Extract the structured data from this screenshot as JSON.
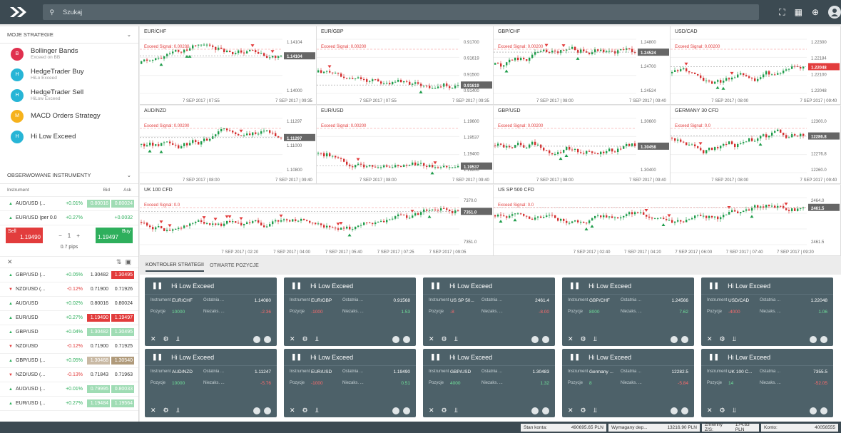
{
  "search": {
    "placeholder": "Szukaj"
  },
  "strategies_header": "MOJE STRATEGIE",
  "strategies": [
    {
      "letter": "B",
      "color": "#e0304e",
      "name": "Bollinger Bands",
      "sub": "Exceed on BB"
    },
    {
      "letter": "H",
      "color": "#27b5d6",
      "name": "HedgeTrader Buy",
      "sub": "HiLo Exceed"
    },
    {
      "letter": "H",
      "color": "#27b5d6",
      "name": "HedgeTrader Sell",
      "sub": "HiLow Exceed"
    },
    {
      "letter": "M",
      "color": "#f6b21c",
      "name": "MACD Orders Strategy",
      "sub": ""
    },
    {
      "letter": "H",
      "color": "#27b5d6",
      "name": "Hi Low Exceed",
      "sub": ""
    }
  ],
  "observed_header": "OBSERWOWANE INSTRUMENTY",
  "inst_cols": {
    "instrument": "Instrument",
    "bid": "Bid",
    "ask": "Ask"
  },
  "instruments_top": [
    {
      "dir": "up",
      "name": "AUD/USD (...",
      "change": "+0.01%",
      "bid": "0.80016",
      "ask": "0.80024",
      "bidbg": "#9fdcb4",
      "askbg": "#9fdcb4"
    },
    {
      "dir": "up",
      "name": "EUR/USD (per 0.000...",
      "change": "+0.27%",
      "bid": "",
      "ask": "+0.0032",
      "bidbg": "",
      "askbg": ""
    }
  ],
  "trade": {
    "sell_label": "Sell",
    "sell_price": "1.19490",
    "buy_label": "Buy",
    "buy_price": "1.19497",
    "qty": "1",
    "pips": "0.7 pips"
  },
  "instruments": [
    {
      "dir": "up",
      "name": "GBP/USD (...",
      "change": "+0.05%",
      "bid": "1.30482",
      "ask": "1.30495",
      "bidbg": "",
      "askbg": "#e23c3c"
    },
    {
      "dir": "dn",
      "name": "NZD/USD (...",
      "change": "-0.12%",
      "bid": "0.71900",
      "ask": "0.71926",
      "bidbg": "",
      "askbg": ""
    },
    {
      "dir": "up",
      "name": "AUD/USD",
      "change": "+0.02%",
      "bid": "0.80016",
      "ask": "0.80024",
      "bidbg": "",
      "askbg": ""
    },
    {
      "dir": "up",
      "name": "EUR/USD",
      "change": "+0.27%",
      "bid": "1.19490",
      "ask": "1.19497",
      "bidbg": "#e23c3c",
      "askbg": "#e23c3c"
    },
    {
      "dir": "up",
      "name": "GBP/USD",
      "change": "+0.04%",
      "bid": "1.30482",
      "ask": "1.30495",
      "bidbg": "#9fdcb4",
      "askbg": "#9fdcb4"
    },
    {
      "dir": "dn",
      "name": "NZD/USD",
      "change": "-0.12%",
      "bid": "0.71900",
      "ask": "0.71925",
      "bidbg": "",
      "askbg": ""
    },
    {
      "dir": "up",
      "name": "GBP/USD (...",
      "change": "+0.05%",
      "bid": "1.30468",
      "ask": "1.30540",
      "bidbg": "#c9b9a4",
      "askbg": "#b09a7a"
    },
    {
      "dir": "dn",
      "name": "NZD/USD (...",
      "change": "-0.13%",
      "bid": "0.71843",
      "ask": "0.71963",
      "bidbg": "",
      "askbg": ""
    },
    {
      "dir": "up",
      "name": "AUD/USD (...",
      "change": "+0.01%",
      "bid": "0.79995",
      "ask": "0.80033",
      "bidbg": "#9fdcb4",
      "askbg": "#9fdcb4"
    },
    {
      "dir": "up",
      "name": "EUR/USD (...",
      "change": "+0.27%",
      "bid": "1.19484",
      "ask": "1.19564",
      "bidbg": "#9fdcb4",
      "askbg": "#9fdcb4"
    }
  ],
  "charts": [
    {
      "title": "EUR/CHF",
      "signal": "Exceed Signal: 0.00200",
      "prices": [
        "1.14104",
        "1.14000"
      ],
      "times": [
        "7 SEP 2017 | 07:55",
        "7 SEP 2017 | 09:35"
      ],
      "badge": "1.14104",
      "badgebg": "#666"
    },
    {
      "title": "EUR/GBP",
      "signal": "Exceed Signal: 0.00200",
      "prices": [
        "0.91700",
        "0.91619",
        "0.91500",
        "0.91400"
      ],
      "times": [
        "7 SEP 2017 | 07:55",
        "7 SEP 2017 | 09:35"
      ],
      "badge": "0.91619",
      "badgebg": "#666"
    },
    {
      "title": "GBP/CHF",
      "signal": "Exceed Signal: 0.00200",
      "prices": [
        "1.24800",
        "1.24700",
        "1.24524"
      ],
      "times": [
        "7 SEP 2017 | 08:00",
        "7 SEP 2017 | 09:40"
      ],
      "badge": "1.24524",
      "badgebg": "#666"
    },
    {
      "title": "USD/CAD",
      "signal": "Exceed Signal: 0.00200",
      "prices": [
        "1.22300",
        "1.22184",
        "1.22100",
        "1.22048"
      ],
      "times": [
        "7 SEP 2017 | 08:00",
        "7 SEP 2017 | 09:40"
      ],
      "badge": "1.22048",
      "badgebg": "#e23c3c"
    },
    {
      "title": "AUD/NZD",
      "signal": "Exceed Signal: 0.00200",
      "prices": [
        "1.11297",
        "1.11000",
        "1.10800"
      ],
      "times": [
        "7 SEP 2017 | 08:00",
        "7 SEP 2017 | 09:40"
      ],
      "badge": "1.11297",
      "badgebg": "#666"
    },
    {
      "title": "EUR/USD",
      "signal": "Exceed Signal: 0.00200",
      "prices": [
        "1.19600",
        "1.19537",
        "1.19400",
        "1.19200"
      ],
      "times": [
        "7 SEP 2017 | 08:00",
        "7 SEP 2017 | 09:40"
      ],
      "badge": "1.19537",
      "badgebg": "#666"
    },
    {
      "title": "GBP/USD",
      "signal": "Exceed Signal: 0.00200",
      "prices": [
        "1.30600",
        "1.30458",
        "1.30400"
      ],
      "times": [
        "7 SEP 2017 | 08:00",
        "7 SEP 2017 | 09:40"
      ],
      "badge": "1.30458",
      "badgebg": "#666"
    },
    {
      "title": "GERMANY 30 CFD",
      "signal": "Exceed Signal: 0.0",
      "prices": [
        "12300.0",
        "12286.8",
        "12276.8",
        "12260.0"
      ],
      "times": [
        "7 SEP 2017 | 08:00",
        "7 SEP 2017 | 09:40"
      ],
      "badge": "12286.8",
      "badgebg": "#666"
    },
    {
      "title": "UK 100 CFD",
      "signal": "Exceed Signal: 0.0",
      "prices": [
        "7370.0",
        "7351.0"
      ],
      "times": [
        "7 SEP 2017 | 02:20",
        "7 SEP 2017 | 04:00",
        "7 SEP 2017 | 05:40",
        "7 SEP 2017 | 07:25",
        "7 SEP 2017 | 09:05"
      ],
      "badge": "7351.0",
      "badgebg": "#666"
    },
    {
      "title": "US SP 500 CFD",
      "signal": "Exceed Signal: 0.0",
      "prices": [
        "2464.0",
        "2461.5"
      ],
      "times": [
        "7 SEP 2017 | 02:40",
        "7 SEP 2017 | 04:20",
        "7 SEP 2017 | 06:00",
        "7 SEP 2017 | 07:40",
        "7 SEP 2017 | 09:20"
      ],
      "badge": "2461.5",
      "badgebg": "#666"
    }
  ],
  "tabs": [
    "KONTROLER STRATEGII",
    "OTWARTE POZYCJE"
  ],
  "card_labels": {
    "title": "Hi Low Exceed",
    "instrument": "Instrument",
    "last": "Ostatnia ...",
    "positions": "Pozycje",
    "unrealized": "Niezaks. ..."
  },
  "cards": [
    {
      "instrument": "EUR/CHF",
      "last": "1.14080",
      "pos": "10000",
      "unr": "-2.36"
    },
    {
      "instrument": "EUR/GBP",
      "last": "0.91568",
      "pos": "-1000",
      "unr": "1.53"
    },
    {
      "instrument": "US SP 50...",
      "last": "2461.4",
      "pos": "-8",
      "unr": "-8.00"
    },
    {
      "instrument": "GBP/CHF",
      "last": "1.24566",
      "pos": "8000",
      "unr": "7.62"
    },
    {
      "instrument": "USD/CAD",
      "last": "1.22048",
      "pos": "-4000",
      "unr": "1.06"
    },
    {
      "instrument": "AUD/NZD",
      "last": "1.11247",
      "pos": "10000",
      "unr": "-5.76"
    },
    {
      "instrument": "EUR/USD",
      "last": "1.19490",
      "pos": "-1000",
      "unr": "0.51"
    },
    {
      "instrument": "GBP/USD",
      "last": "1.30483",
      "pos": "4000",
      "unr": "1.32"
    },
    {
      "instrument": "Germany ...",
      "last": "12282.5",
      "pos": "8",
      "unr": "-5.84"
    },
    {
      "instrument": "UK 100 C...",
      "last": "7355.5",
      "pos": "14",
      "unr": "-52.05"
    }
  ],
  "status": [
    {
      "label": "Stan konta:",
      "value": "490695.65 PLN"
    },
    {
      "label": "Wymagany dep...",
      "value": "13216.90 PLN"
    },
    {
      "label": "Zmienny Z/S:",
      "value": "174.83 PLN"
    },
    {
      "label": "Konto:",
      "value": "40056555"
    }
  ]
}
